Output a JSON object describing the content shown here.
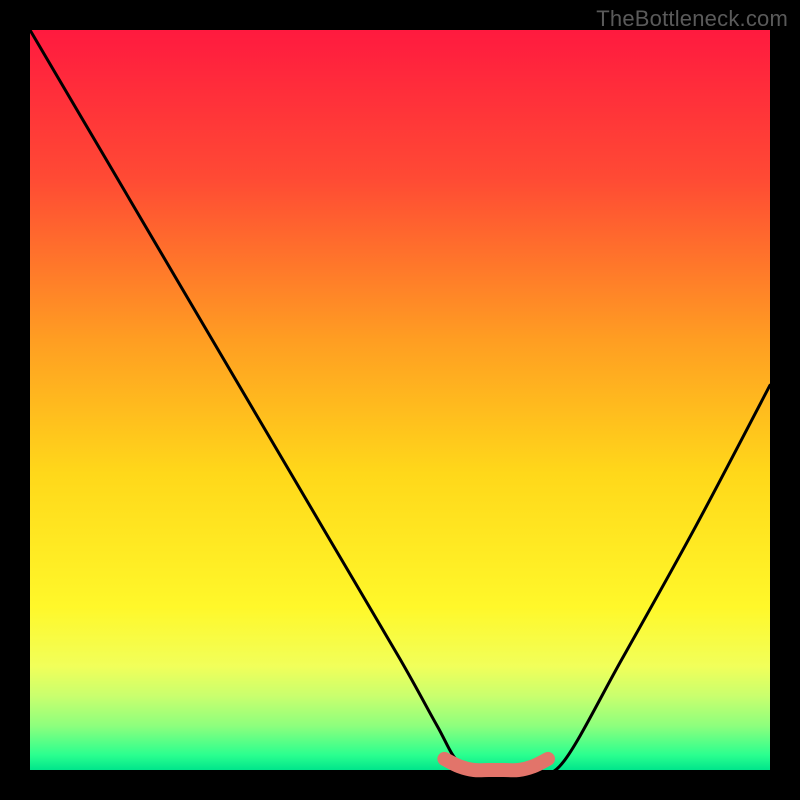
{
  "watermark": "TheBottleneck.com",
  "chart_data": {
    "type": "line",
    "title": "",
    "xlabel": "",
    "ylabel": "",
    "xlim": [
      0,
      100
    ],
    "ylim": [
      0,
      100
    ],
    "series": [
      {
        "name": "bottleneck-curve",
        "x": [
          0,
          10,
          20,
          30,
          40,
          50,
          55,
          58,
          62,
          68,
          72,
          80,
          90,
          100
        ],
        "y": [
          100,
          83,
          66,
          49,
          32,
          15,
          6,
          1,
          0,
          0,
          1,
          15,
          33,
          52
        ]
      },
      {
        "name": "optimal-band",
        "x": [
          56,
          58,
          60,
          62,
          64,
          66,
          68,
          70
        ],
        "y": [
          1.5,
          0.5,
          0.0,
          0.0,
          0.0,
          0.0,
          0.5,
          1.5
        ]
      }
    ],
    "background": {
      "type": "vertical-gradient",
      "stops": [
        {
          "pos": 0.0,
          "color": "#ff1a3f"
        },
        {
          "pos": 0.2,
          "color": "#ff4a34"
        },
        {
          "pos": 0.42,
          "color": "#ff9e22"
        },
        {
          "pos": 0.6,
          "color": "#ffd81a"
        },
        {
          "pos": 0.78,
          "color": "#fff82a"
        },
        {
          "pos": 0.86,
          "color": "#f1ff5a"
        },
        {
          "pos": 0.9,
          "color": "#c9ff6e"
        },
        {
          "pos": 0.94,
          "color": "#8eff7d"
        },
        {
          "pos": 0.98,
          "color": "#2aff8f"
        },
        {
          "pos": 1.0,
          "color": "#00e58b"
        }
      ]
    },
    "annotation_color": "#e2746a"
  }
}
